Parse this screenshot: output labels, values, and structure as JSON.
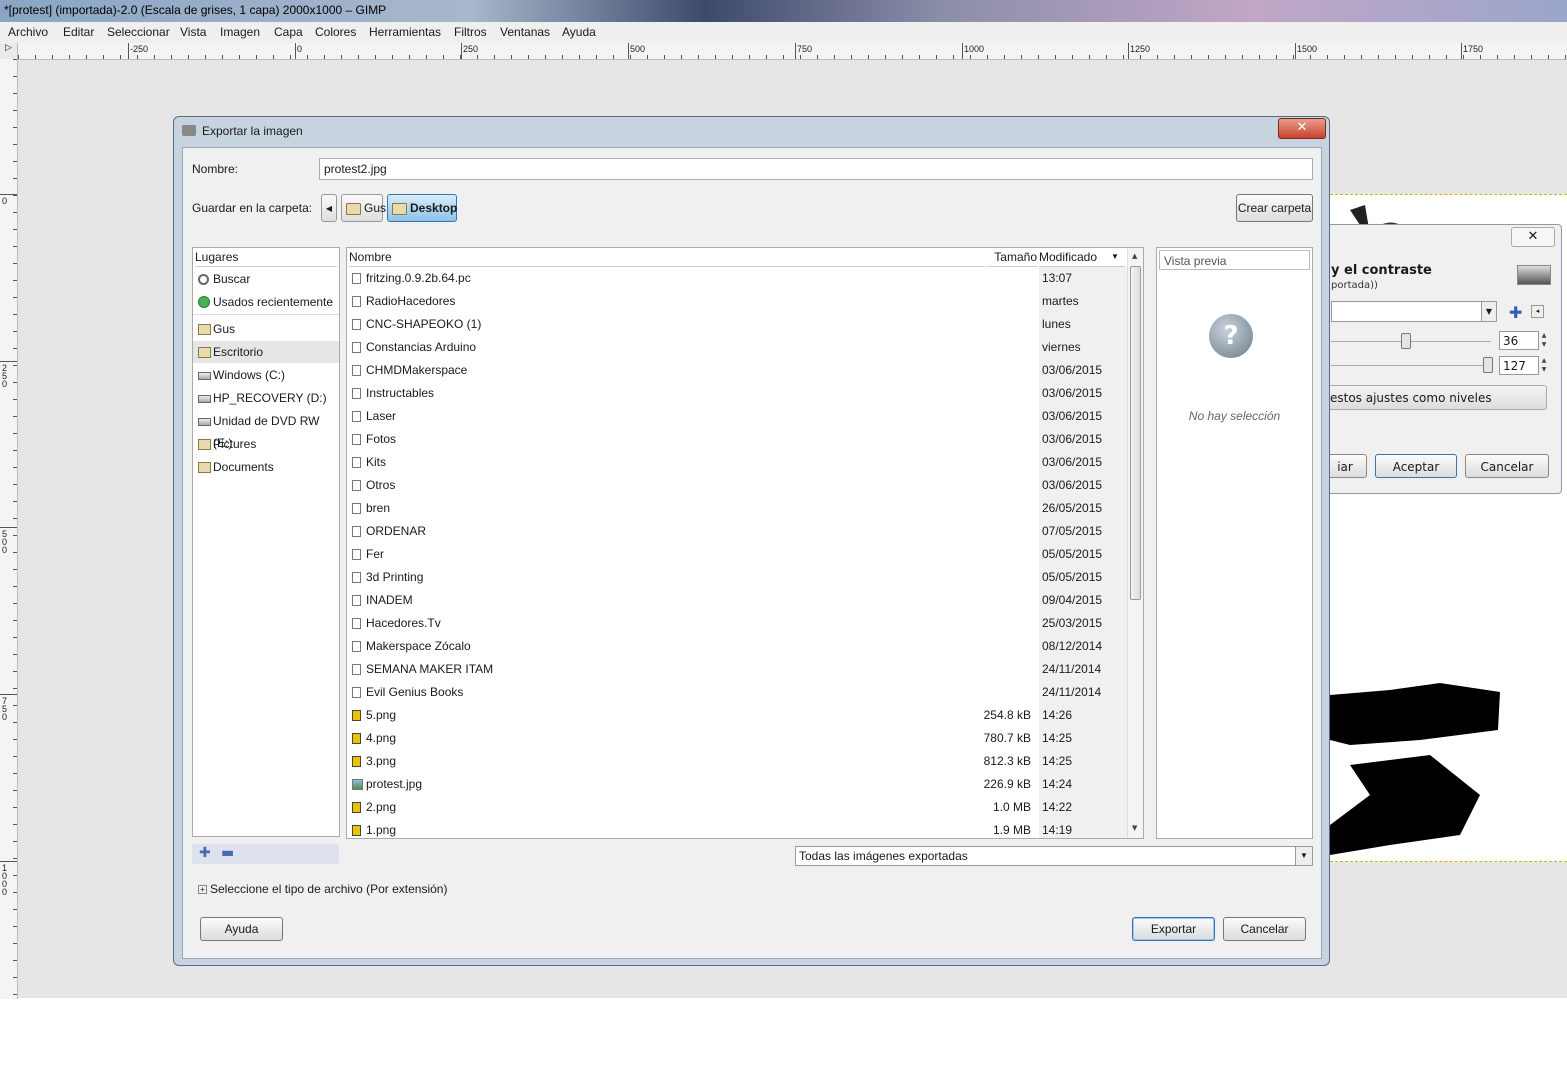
{
  "window": {
    "title": "*[protest] (importada)-2.0 (Escala de grises, 1 capa) 2000x1000 – GIMP"
  },
  "menubar": [
    "Archivo",
    "Editar",
    "Seleccionar",
    "Vista",
    "Imagen",
    "Capa",
    "Colores",
    "Herramientas",
    "Filtros",
    "Ventanas",
    "Ayuda"
  ],
  "ruler": {
    "h_labels": [
      "-250",
      "0",
      "250",
      "500",
      "750",
      "1000",
      "1250",
      "1500",
      "1750"
    ],
    "v_labels": [
      "0",
      "250",
      "500",
      "750",
      "1000"
    ]
  },
  "bc_dialog": {
    "title": "y el contraste",
    "subtitle": "portada))",
    "close": "✕",
    "brightness": "36",
    "contrast": "127",
    "levels_button": "estos ajustes como niveles",
    "reset_button": "iar",
    "accept_button": "Aceptar",
    "cancel_button": "Cancelar"
  },
  "export_dialog": {
    "title": "Exportar la imagen",
    "close": "✕",
    "name_label": "Nombre:",
    "name_value": "protest2.jpg",
    "folder_label": "Guardar en la carpeta:",
    "path": [
      "Gus",
      "Desktop"
    ],
    "create_folder": "Crear carpeta",
    "places_header": "Lugares",
    "places": [
      {
        "label": "Buscar",
        "icon": "search-icon"
      },
      {
        "label": "Usados recientemente",
        "icon": "recent-icon"
      },
      {
        "label": "Gus",
        "icon": "folder-icon"
      },
      {
        "label": "Escritorio",
        "icon": "folder-icon"
      },
      {
        "label": "Windows  (C:)",
        "icon": "drive-icon"
      },
      {
        "label": "HP_RECOVERY (D:)",
        "icon": "drive-icon"
      },
      {
        "label": "Unidad de DVD RW (E:)",
        "icon": "dvd-icon"
      },
      {
        "label": "Pictures",
        "icon": "folder-icon"
      },
      {
        "label": "Documents",
        "icon": "folder-icon"
      }
    ],
    "columns": {
      "name": "Nombre",
      "size": "Tamaño",
      "modified": "Modificado"
    },
    "files": [
      {
        "name": "fritzing.0.9.2b.64.pc",
        "size": "",
        "modified": "13:07",
        "type": "folder"
      },
      {
        "name": "RadioHacedores",
        "size": "",
        "modified": "martes",
        "type": "folder"
      },
      {
        "name": "CNC-SHAPEOKO (1)",
        "size": "",
        "modified": "lunes",
        "type": "folder"
      },
      {
        "name": "Constancias Arduino",
        "size": "",
        "modified": "viernes",
        "type": "folder"
      },
      {
        "name": "CHMDMakerspace",
        "size": "",
        "modified": "03/06/2015",
        "type": "folder"
      },
      {
        "name": "Instructables",
        "size": "",
        "modified": "03/06/2015",
        "type": "folder"
      },
      {
        "name": "Laser",
        "size": "",
        "modified": "03/06/2015",
        "type": "folder"
      },
      {
        "name": "Fotos",
        "size": "",
        "modified": "03/06/2015",
        "type": "folder"
      },
      {
        "name": "Kits",
        "size": "",
        "modified": "03/06/2015",
        "type": "folder"
      },
      {
        "name": "Otros",
        "size": "",
        "modified": "03/06/2015",
        "type": "folder"
      },
      {
        "name": "bren",
        "size": "",
        "modified": "26/05/2015",
        "type": "folder"
      },
      {
        "name": "ORDENAR",
        "size": "",
        "modified": "07/05/2015",
        "type": "folder"
      },
      {
        "name": "Fer",
        "size": "",
        "modified": "05/05/2015",
        "type": "folder"
      },
      {
        "name": "3d Printing",
        "size": "",
        "modified": "05/05/2015",
        "type": "folder"
      },
      {
        "name": "INADEM",
        "size": "",
        "modified": "09/04/2015",
        "type": "folder"
      },
      {
        "name": "Hacedores.Tv",
        "size": "",
        "modified": "25/03/2015",
        "type": "folder"
      },
      {
        "name": "Makerspace Zócalo",
        "size": "",
        "modified": "08/12/2014",
        "type": "folder"
      },
      {
        "name": "SEMANA MAKER ITAM",
        "size": "",
        "modified": "24/11/2014",
        "type": "folder"
      },
      {
        "name": "Evil Genius Books",
        "size": "",
        "modified": "24/11/2014",
        "type": "folder"
      },
      {
        "name": "5.png",
        "size": "254.8 kB",
        "modified": "14:26",
        "type": "png"
      },
      {
        "name": "4.png",
        "size": "780.7 kB",
        "modified": "14:25",
        "type": "png"
      },
      {
        "name": "3.png",
        "size": "812.3 kB",
        "modified": "14:25",
        "type": "png"
      },
      {
        "name": "protest.jpg",
        "size": "226.9 kB",
        "modified": "14:24",
        "type": "jpg"
      },
      {
        "name": "2.png",
        "size": "1.0 MB",
        "modified": "14:22",
        "type": "png"
      },
      {
        "name": "1.png",
        "size": "1.9 MB",
        "modified": "14:19",
        "type": "png"
      }
    ],
    "preview_label": "Vista previa",
    "no_selection": "No hay selección",
    "filter": "Todas las imágenes exportadas",
    "file_type_expander": "Seleccione el tipo de archivo (Por extensión)",
    "help_button": "Ayuda",
    "export_button": "Exportar",
    "cancel_button": "Cancelar"
  }
}
